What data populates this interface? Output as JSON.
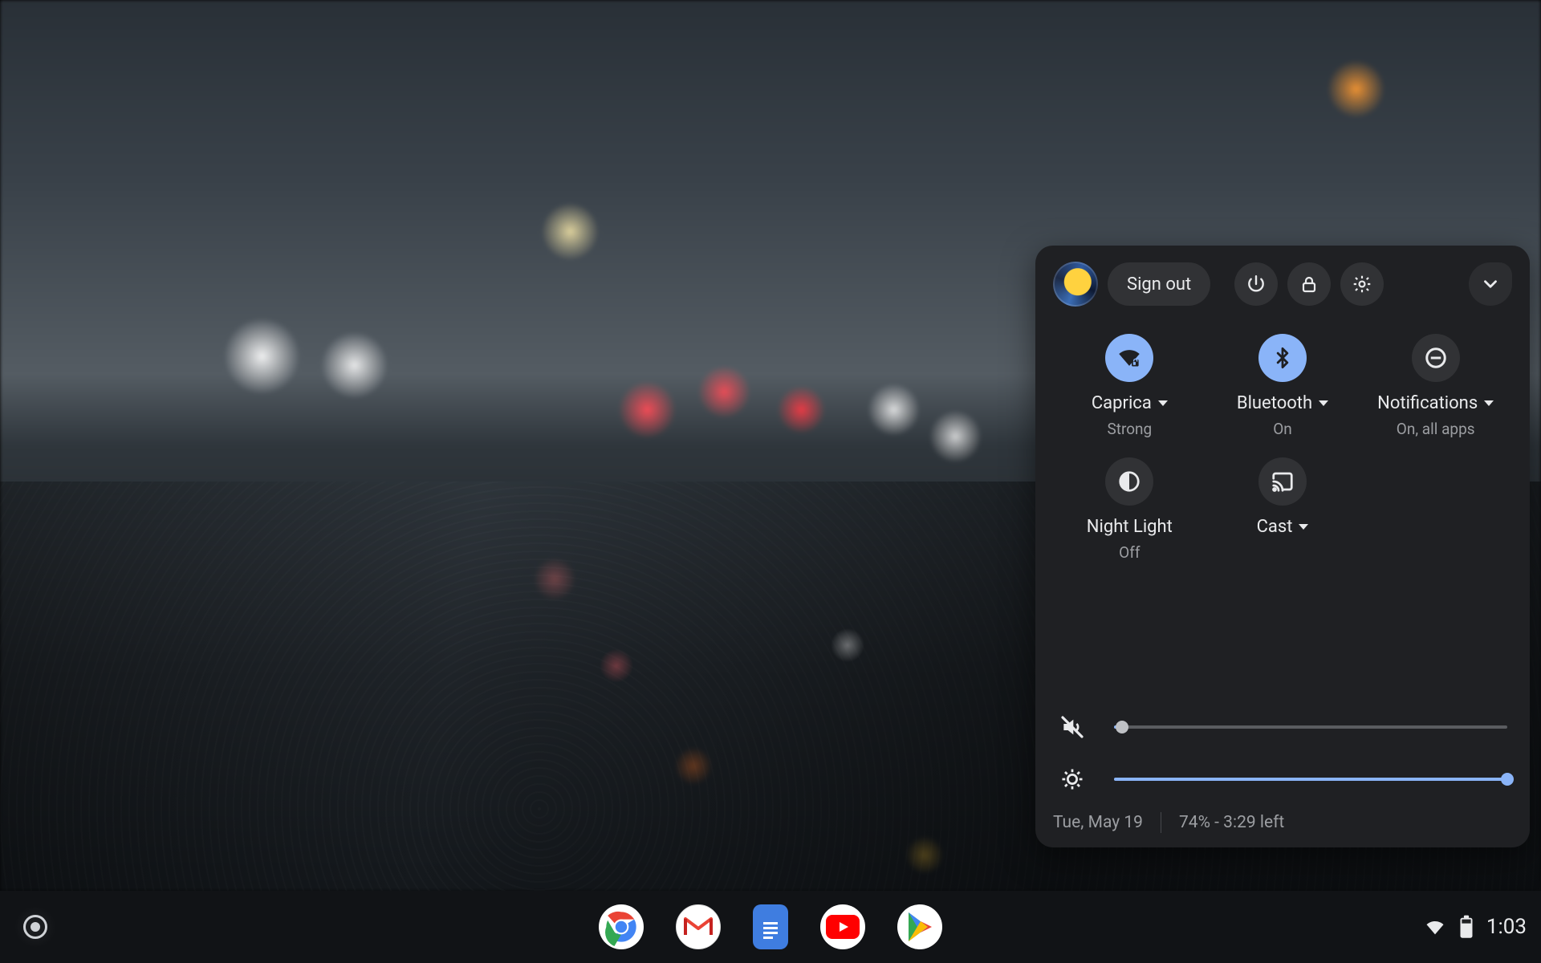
{
  "panel": {
    "sign_out_label": "Sign out",
    "tiles": {
      "wifi": {
        "label": "Caprica",
        "sub": "Strong",
        "has_caret": true,
        "active": true
      },
      "bluetooth": {
        "label": "Bluetooth",
        "sub": "On",
        "has_caret": true,
        "active": true
      },
      "notifications": {
        "label": "Notifications",
        "sub": "On, all apps",
        "has_caret": true,
        "active": false
      },
      "nightlight": {
        "label": "Night Light",
        "sub": "Off",
        "has_caret": false,
        "active": false
      },
      "cast": {
        "label": "Cast",
        "sub": "",
        "has_caret": true,
        "active": false
      }
    },
    "sliders": {
      "volume_percent": 2,
      "brightness_percent": 100
    },
    "footer": {
      "date": "Tue, May 19",
      "battery": "74% - 3:29 left"
    }
  },
  "shelf": {
    "status": {
      "time": "1:03"
    }
  },
  "colors": {
    "accent": "#8ab4f8",
    "panel_bg": "#1f2023"
  }
}
